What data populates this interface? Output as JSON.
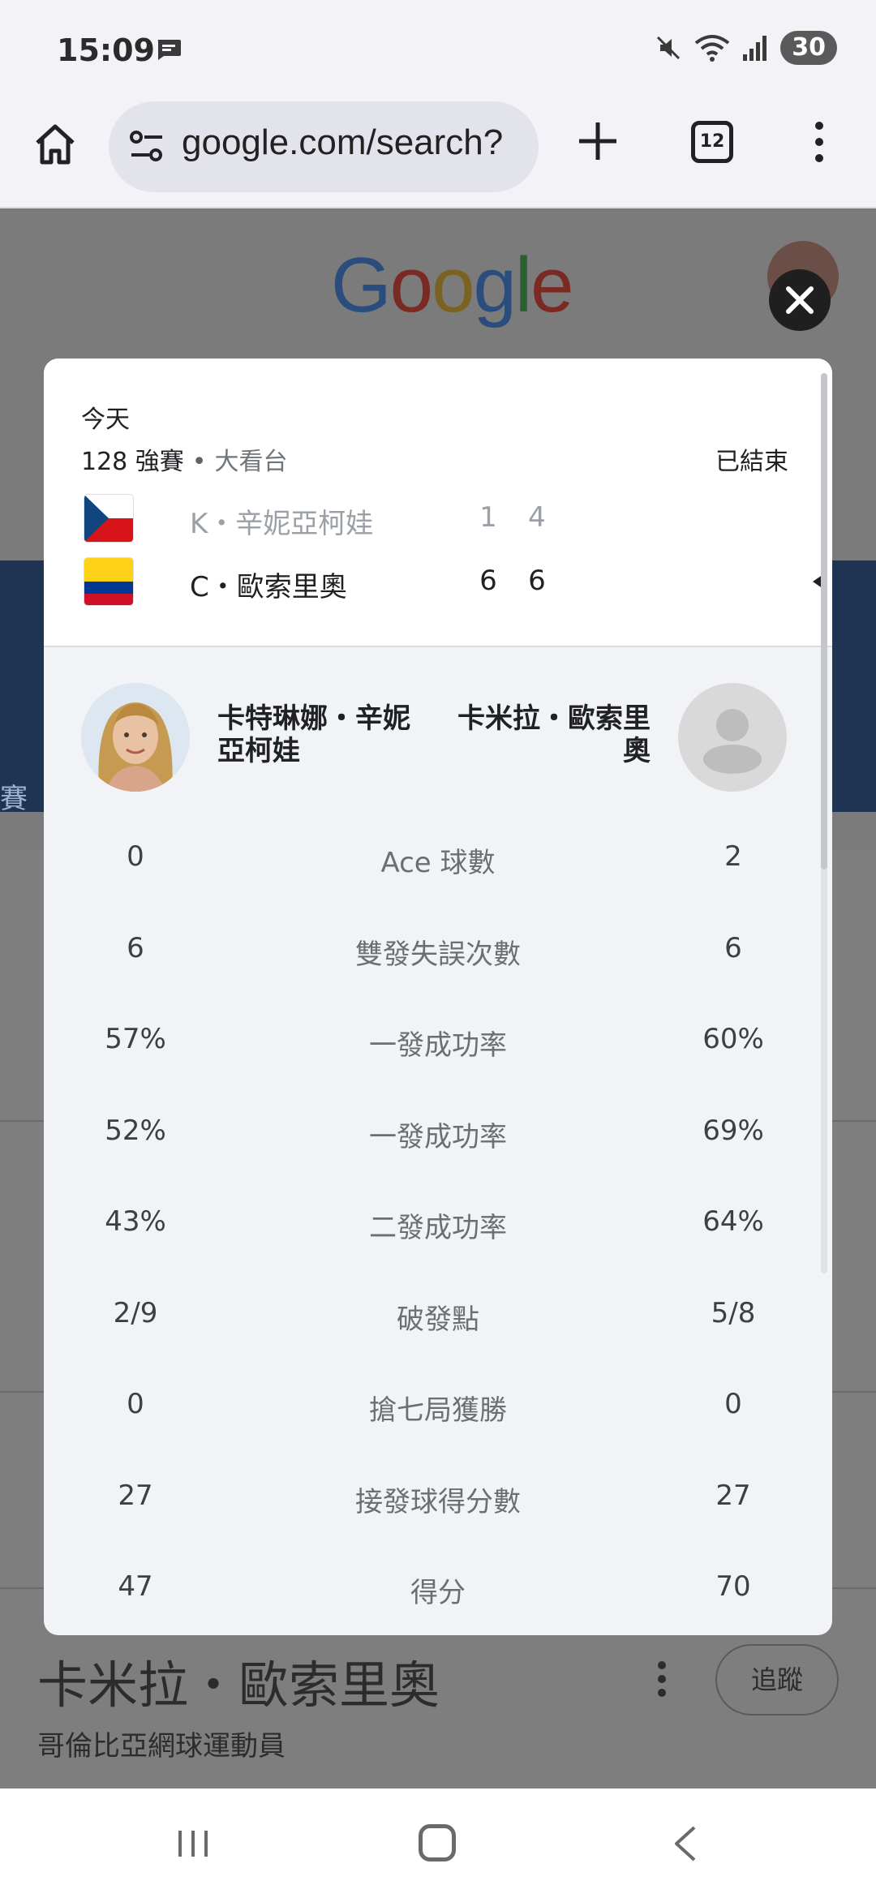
{
  "status_bar": {
    "time": "15:09",
    "battery": "30"
  },
  "browser": {
    "url": "google.com/search?",
    "tab_count": "12"
  },
  "background": {
    "logo_letters": [
      "G",
      "o",
      "o",
      "g",
      "l",
      "e"
    ],
    "tab_left": "賽",
    "player_name": "卡米拉・歐索里奧",
    "player_sub": "哥倫比亞網球運動員",
    "follow_label": "追蹤"
  },
  "match": {
    "date": "今天",
    "round": "128 強賽",
    "court": "大看台",
    "status": "已結束",
    "players": [
      {
        "name": "K・辛妮亞柯娃",
        "flag": "czech-flag",
        "sets": [
          "1",
          "4"
        ],
        "winner": false
      },
      {
        "name": "C・歐索里奧",
        "flag": "colombia-flag",
        "sets": [
          "6",
          "6"
        ],
        "winner": true
      }
    ]
  },
  "comparison": {
    "player1": "卡特琳娜・辛妮亞柯娃",
    "player2": "卡米拉・歐索里奧",
    "stats": [
      {
        "label": "Ace 球數",
        "p1": "0",
        "p2": "2"
      },
      {
        "label": "雙發失誤次數",
        "p1": "6",
        "p2": "6"
      },
      {
        "label": "一發成功率",
        "p1": "57%",
        "p2": "60%"
      },
      {
        "label": "一發成功率",
        "p1": "52%",
        "p2": "69%"
      },
      {
        "label": "二發成功率",
        "p1": "43%",
        "p2": "64%"
      },
      {
        "label": "破發點",
        "p1": "2/9",
        "p2": "5/8"
      },
      {
        "label": "搶七局獲勝",
        "p1": "0",
        "p2": "0"
      },
      {
        "label": "接發球得分數",
        "p1": "27",
        "p2": "27"
      },
      {
        "label": "得分",
        "p1": "47",
        "p2": "70"
      }
    ]
  }
}
